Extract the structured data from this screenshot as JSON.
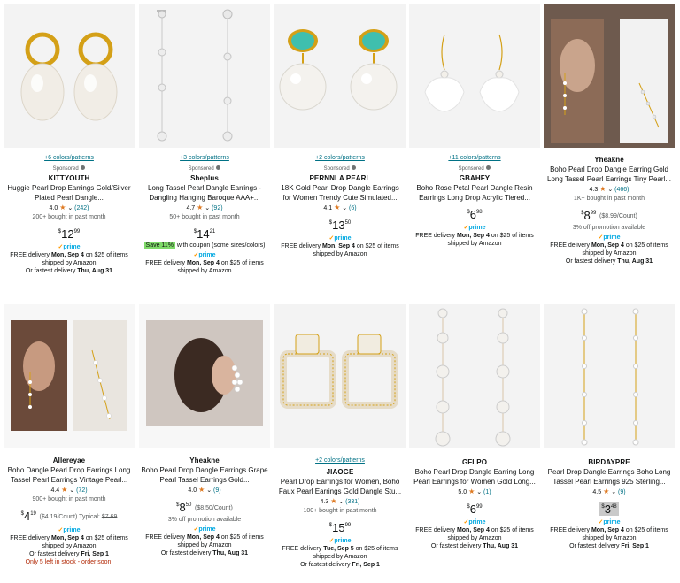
{
  "products": [
    {
      "brand": "KITTYOUTH",
      "colors": "+6 colors/patterns",
      "sponsored": "Sponsored",
      "title": "Huggie Pearl Drop Earrings Gold/Silver Plated Pearl Dangle...",
      "rating": "4.0",
      "reviews": "(242)",
      "bought": "200+ bought in past month",
      "price_whole": "12",
      "price_frac": "99",
      "prime": "prime",
      "delivery1": "FREE delivery ",
      "delivery_date": "Mon, Sep 4",
      "delivery2": " on $25 of items shipped by Amazon",
      "fastest": "Or fastest delivery ",
      "fastest_date": "Thu, Aug 31"
    },
    {
      "brand": "Sheplus",
      "colors": "+3 colors/patterns",
      "sponsored": "Sponsored",
      "title": "Long Tassel Pearl Dangle Earrings - Dangling Hanging Baroque AAA+...",
      "rating": "4.7",
      "reviews": "(92)",
      "bought": "50+ bought in past month",
      "price_whole": "14",
      "price_frac": "21",
      "coupon_badge": "Save 11%",
      "coupon_text": " with coupon (some sizes/colors)",
      "prime": "prime",
      "delivery1": "FREE delivery ",
      "delivery_date": "Mon, Sep 4",
      "delivery2": " on $25 of items shipped by Amazon"
    },
    {
      "brand": "PERNNLA PEARL",
      "colors": "+2 colors/patterns",
      "sponsored": "Sponsored",
      "title": "18K Gold Pearl Drop Dangle Earrings for Women Trendy Cute Simulated...",
      "rating": "4.1",
      "reviews": "(6)",
      "price_whole": "13",
      "price_frac": "50",
      "prime": "prime",
      "delivery1": "FREE delivery ",
      "delivery_date": "Mon, Sep 4",
      "delivery2": " on $25 of items shipped by Amazon"
    },
    {
      "brand": "GBAHFY",
      "colors": "+11 colors/patterns",
      "sponsored": "Sponsored",
      "title": "Boho Rose Petal Pearl Dangle Resin Earrings Long Drop Acrylic Tiered...",
      "price_whole": "6",
      "price_frac": "98",
      "prime": "prime",
      "delivery1": "FREE delivery ",
      "delivery_date": "Mon, Sep 4",
      "delivery2": " on $25 of items shipped by Amazon"
    },
    {
      "brand": "Yheakne",
      "title": "Boho Pearl Drop Dangle Earring Gold Long Tassel Pearl Earrings Tiny Pearl...",
      "rating": "4.3",
      "reviews": "(466)",
      "bought": "1K+ bought in past month",
      "price_whole": "8",
      "price_frac": "99",
      "unit_price": "($8.99/Count)",
      "promo": "3% off promotion available",
      "prime": "prime",
      "delivery1": "FREE delivery ",
      "delivery_date": "Mon, Sep 4",
      "delivery2": " on $25 of items shipped by Amazon",
      "fastest": "Or fastest delivery ",
      "fastest_date": "Thu, Aug 31"
    },
    {
      "brand": "Allereyae",
      "title": "Boho Dangle Pearl Drop Earrings Long Tassel Pearl Earrings Vintage Pearl...",
      "rating": "4.4",
      "reviews": "(72)",
      "bought": "900+ bought in past month",
      "price_whole": "4",
      "price_frac": "19",
      "unit_price": "($4.19/Count) Typical: ",
      "typical": "$7.69",
      "prime": "prime",
      "delivery1": "FREE delivery ",
      "delivery_date": "Mon, Sep 4",
      "delivery2": " on $25 of items shipped by Amazon",
      "fastest": "Or fastest delivery ",
      "fastest_date": "Fri, Sep 1",
      "stock": "Only 5 left in stock - order soon."
    },
    {
      "brand": "Yheakne",
      "title": "Boho Pearl Drop Dangle Earrings Grape Pearl Tassel Earrings Gold...",
      "rating": "4.0",
      "reviews": "(9)",
      "price_whole": "8",
      "price_frac": "50",
      "unit_price": "($8.50/Count)",
      "promo": "3% off promotion available",
      "prime": "prime",
      "delivery1": "FREE delivery ",
      "delivery_date": "Mon, Sep 4",
      "delivery2": " on $25 of items shipped by Amazon",
      "fastest": "Or fastest delivery ",
      "fastest_date": "Thu, Aug 31"
    },
    {
      "brand": "JIAOGE",
      "colors": "+2 colors/patterns",
      "title": "Pearl Drop Earrings for Women, Boho Faux Pearl Earrings Gold Dangle Stu...",
      "rating": "4.3",
      "reviews": "(331)",
      "bought": "100+ bought in past month",
      "price_whole": "15",
      "price_frac": "99",
      "prime": "prime",
      "delivery1": "FREE delivery ",
      "delivery_date": "Tue, Sep 5",
      "delivery2": " on $25 of items shipped by Amazon",
      "fastest": "Or fastest delivery ",
      "fastest_date": "Fri, Sep 1"
    },
    {
      "brand": "GFLPO",
      "title": "Boho Pearl Drop Dangle Earring Long Pearl Earrings for Women Gold Long...",
      "rating": "5.0",
      "reviews": "(1)",
      "price_whole": "6",
      "price_frac": "99",
      "prime": "prime",
      "delivery1": "FREE delivery ",
      "delivery_date": "Mon, Sep 4",
      "delivery2": " on $25 of items shipped by Amazon",
      "fastest": "Or fastest delivery ",
      "fastest_date": "Thu, Aug 31"
    },
    {
      "brand": "BIRDAYPRE",
      "title": "Pearl Drop Dangle Earrings Boho Long Tassel Pearl Earrings 925 Sterling...",
      "rating": "4.5",
      "reviews": "(9)",
      "price_whole": "3",
      "price_frac": "48",
      "prime": "prime",
      "delivery1": "FREE delivery ",
      "delivery_date": "Mon, Sep 4",
      "delivery2": " on $25 of items shipped by Amazon",
      "fastest": "Or fastest delivery ",
      "fastest_date": "Fri, Sep 1"
    }
  ],
  "colors": {
    "link": "#007185",
    "star": "#de7921",
    "prime": "#00A8E1",
    "deal_red": "#B12704",
    "coupon": "#7fda69"
  }
}
